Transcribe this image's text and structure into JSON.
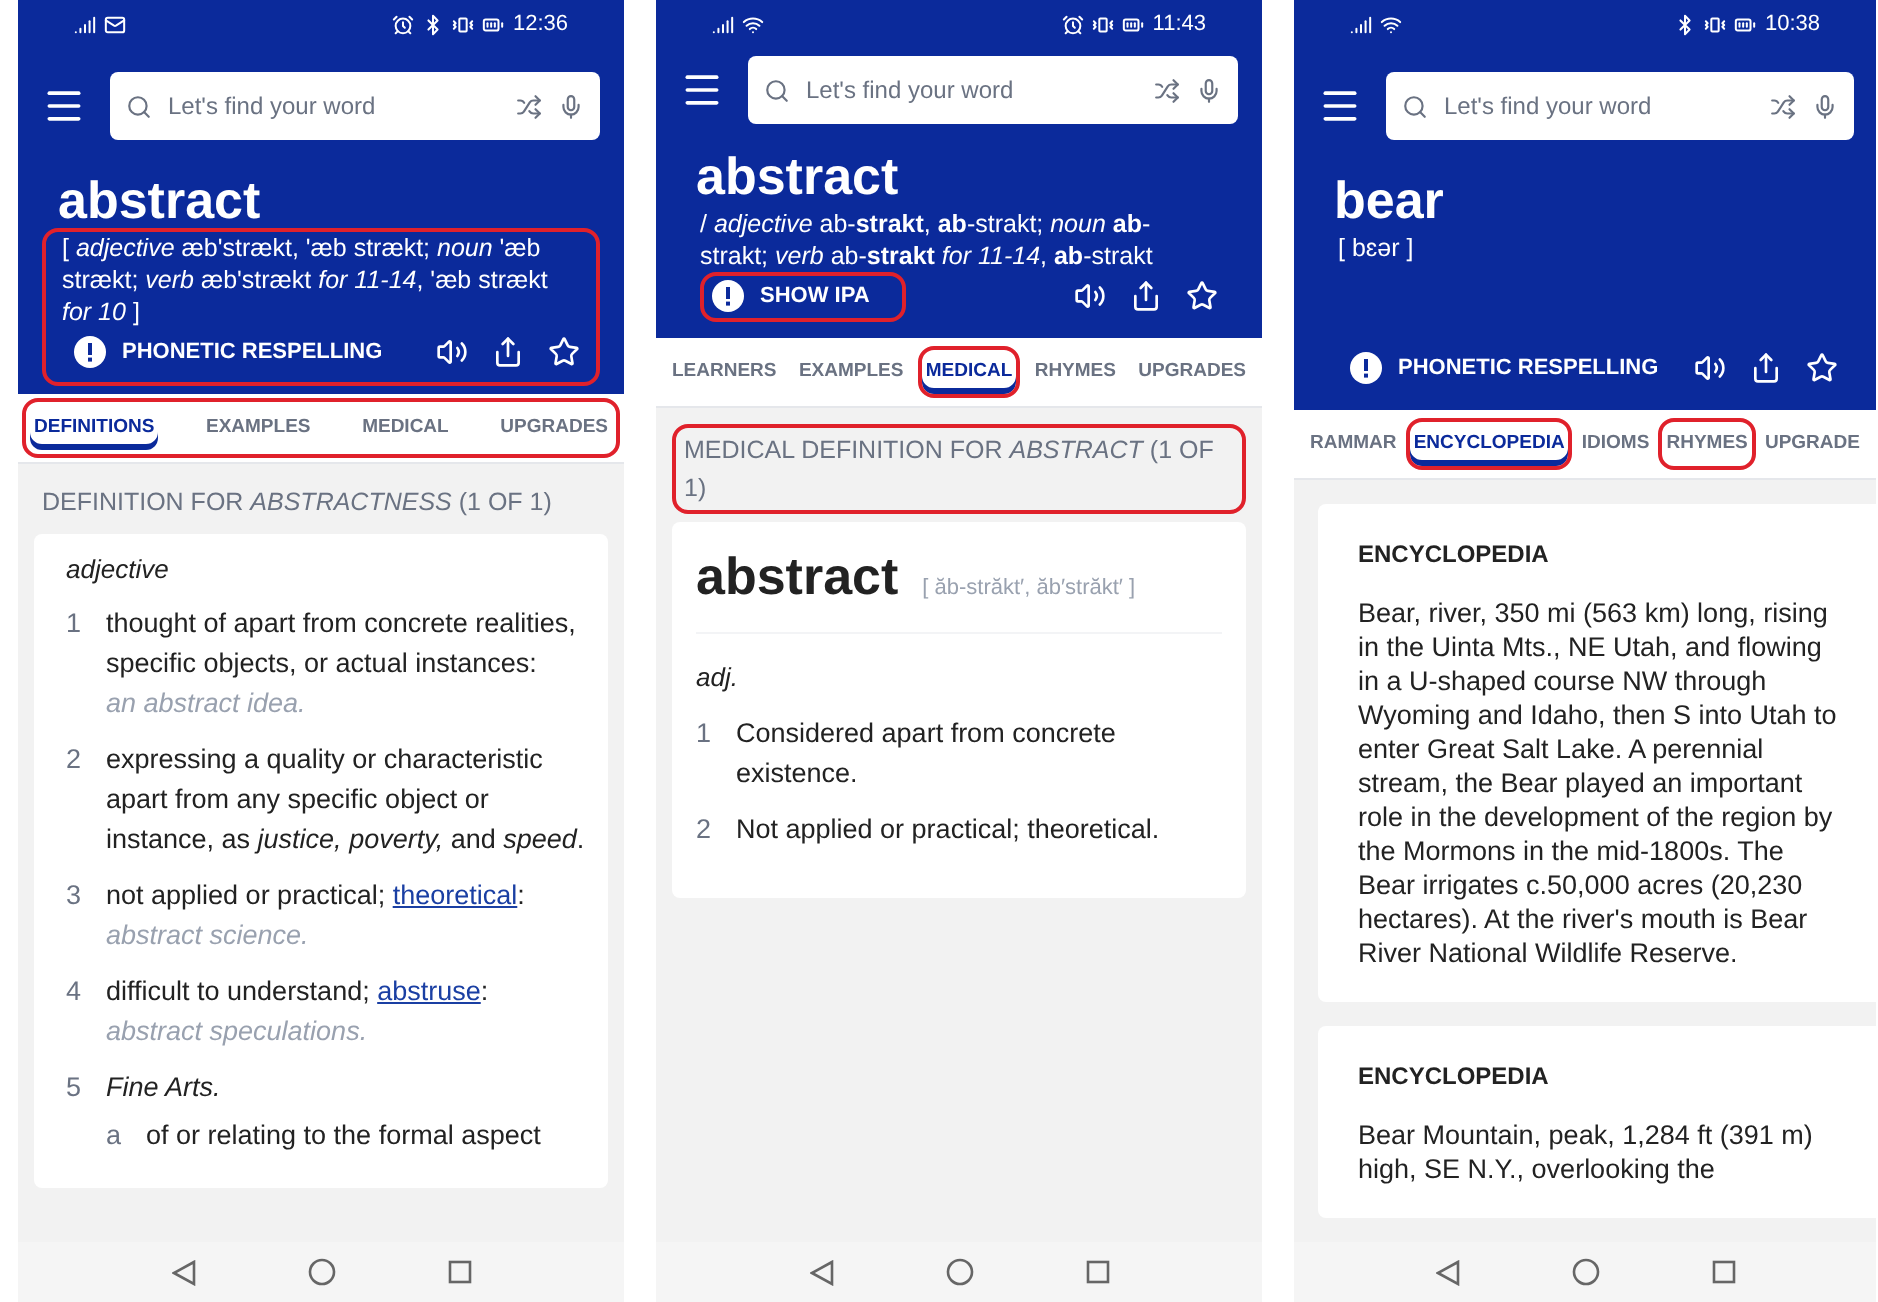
{
  "phones": [
    {
      "kind": "definitions",
      "status_bar": {
        "mail": true,
        "alarm": true,
        "bluetooth": true,
        "time": "12:36"
      },
      "search": {
        "placeholder": "Let's find your word"
      },
      "headword": "abstract",
      "pronunciation": "[ *adjective* æb'strækt, 'æb strækt; *noun* 'æb strækt; *verb* æb'strækt *for 11-14*, 'æb strækt *for 10*  ]",
      "pronunciation_highlighted": true,
      "pronunciation_button": {
        "label": "PHONETIC RESPELLING",
        "highlighted": false
      },
      "tabs_highlighted": true,
      "tabs": [
        {
          "label": "DEFINITIONS",
          "selected": true,
          "highlighted": false
        },
        {
          "label": "EXAMPLES",
          "selected": false,
          "highlighted": false
        },
        {
          "label": "MEDICAL",
          "selected": false,
          "highlighted": false
        },
        {
          "label": "UPGRADES",
          "selected": false,
          "highlighted": false
        }
      ],
      "section_header": {
        "text": "DEFINITION FOR *ABSTRACTNESS* (1 OF 1)",
        "highlighted": false
      },
      "part_of_speech": "adjective",
      "senses": [
        {
          "number": "1",
          "text": "thought of apart from concrete realities, specific objects, or actual instances:",
          "example": "an abstract idea."
        },
        {
          "number": "2",
          "text": "expressing a quality or characteristic apart from any specific object or instance, as *justice, poverty,* and *speed*."
        },
        {
          "number": "3",
          "text": "not applied or practical; ",
          "link": "theoretical",
          "text_after": ":",
          "example": "abstract science."
        },
        {
          "number": "4",
          "text": "difficult to understand; ",
          "link": "abstruse",
          "text_after": ":",
          "example": "abstract speculations."
        },
        {
          "number": "5",
          "text": "*Fine Arts.*",
          "subsenses": [
            {
              "number": "a",
              "text": "of or relating to the formal aspect"
            }
          ]
        }
      ]
    },
    {
      "kind": "medical",
      "status_bar": {
        "wifi": true,
        "alarm": true,
        "time": "11:43"
      },
      "search": {
        "placeholder": "Let's find your word"
      },
      "headword": "abstract",
      "pronunciation": "/ *adjective* ab-**strakt**, **ab**-strakt; *noun* **ab**-strakt; *verb* ab-**strakt** *for 11-14*,  **ab**-strakt",
      "pronunciation_highlighted": false,
      "pronunciation_button": {
        "label": "SHOW IPA",
        "highlighted": true
      },
      "tabs_highlighted": false,
      "tabs": [
        {
          "label": "LEARNERS",
          "selected": false,
          "highlighted": false
        },
        {
          "label": "EXAMPLES",
          "selected": false,
          "highlighted": false
        },
        {
          "label": "MEDICAL",
          "selected": true,
          "highlighted": true
        },
        {
          "label": "RHYMES",
          "selected": false,
          "highlighted": false
        },
        {
          "label": "UPGRADES",
          "selected": false,
          "highlighted": false
        }
      ],
      "section_header": {
        "text": "MEDICAL DEFINITION FOR *ABSTRACT* (1 OF 1)",
        "highlighted": true
      },
      "card_headword": "abstract",
      "card_pronunciation": "[ ăb-străkt′, ăb′străkt′ ]",
      "part_of_speech": "adj.",
      "senses": [
        {
          "number": "1",
          "text": "Considered apart from concrete existence."
        },
        {
          "number": "2",
          "text": "Not applied or practical; theoretical."
        }
      ]
    },
    {
      "kind": "encyclopedia",
      "status_bar": {
        "wifi": true,
        "bluetooth": true,
        "time": "10:38"
      },
      "search": {
        "placeholder": "Let's find your word"
      },
      "headword": "bear",
      "pronunciation": "[ bɛər  ]",
      "pronunciation_highlighted": false,
      "pronunciation_button": {
        "label": "PHONETIC RESPELLING",
        "highlighted": false
      },
      "tabs_highlighted": false,
      "tabs": [
        {
          "label": "RAMMAR",
          "selected": false,
          "highlighted": false
        },
        {
          "label": "ENCYCLOPEDIA",
          "selected": true,
          "highlighted": true
        },
        {
          "label": "IDIOMS",
          "selected": false,
          "highlighted": false
        },
        {
          "label": "RHYMES",
          "selected": false,
          "highlighted": true
        },
        {
          "label": "UPGRADE",
          "selected": false,
          "highlighted": false
        }
      ],
      "entries": [
        {
          "title": "ENCYCLOPEDIA",
          "text": "Bear, river, 350 mi (563 km) long, rising in the Uinta Mts., NE Utah, and flowing in a U-shaped course NW through Wyoming and Idaho, then S into Utah to enter Great Salt Lake. A perennial stream, the Bear played an important role in the development of the region by the Mormons in the mid-1800s. The Bear irrigates c.50,000 acres (20,230 hectares). At the river's mouth is Bear River National Wildlife Reserve."
        },
        {
          "title": "ENCYCLOPEDIA",
          "text": "Bear Mountain, peak, 1,284 ft (391 m) high, SE N.Y., overlooking the"
        }
      ]
    }
  ]
}
